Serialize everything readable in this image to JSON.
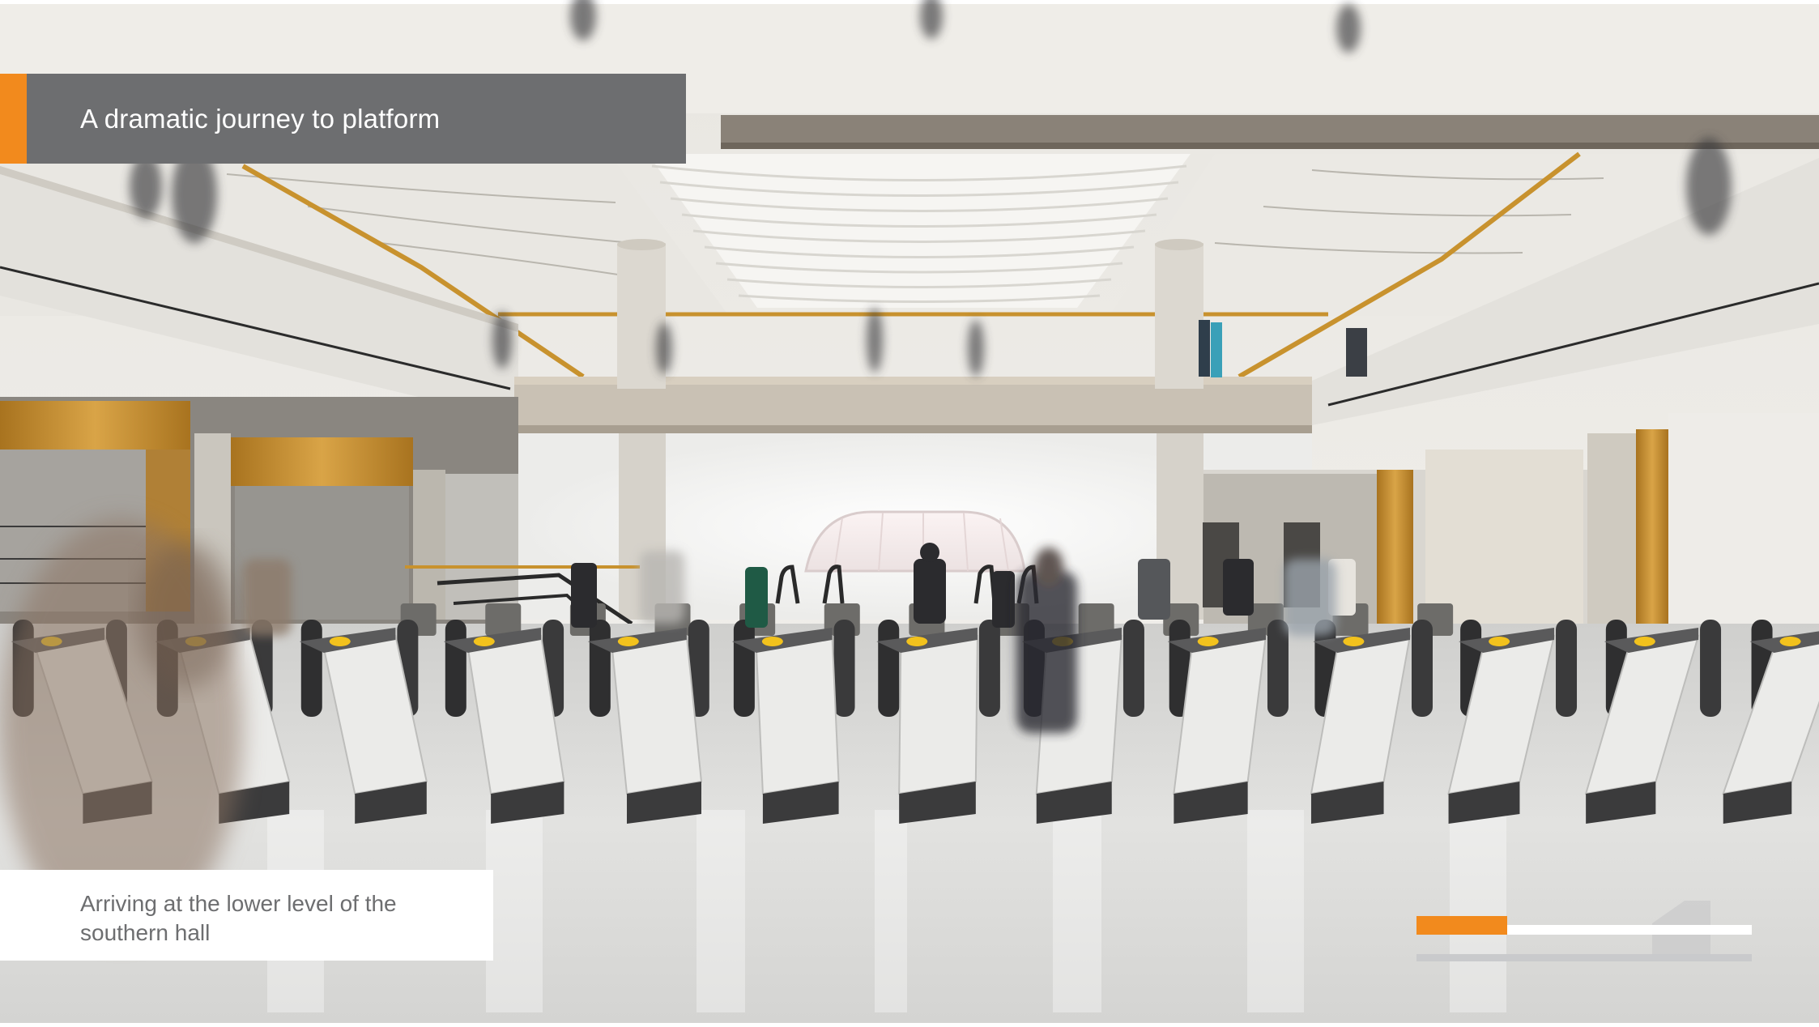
{
  "slide": {
    "title": "A dramatic journey to platform",
    "caption": "Arriving at the lower level of the southern hall",
    "progress_fraction": 0.27
  },
  "colors": {
    "accent": "#f28a1d",
    "title_bar": "#6d6e70",
    "caption_text": "#6d6e70",
    "caption_bg": "#ffffff",
    "brass": "#c8922e",
    "floor": "#dcdcda"
  },
  "scene": {
    "subject": "station ticket hall with ticket gates, mezzanine walkway, columns and escalators",
    "gate_count": 13
  }
}
